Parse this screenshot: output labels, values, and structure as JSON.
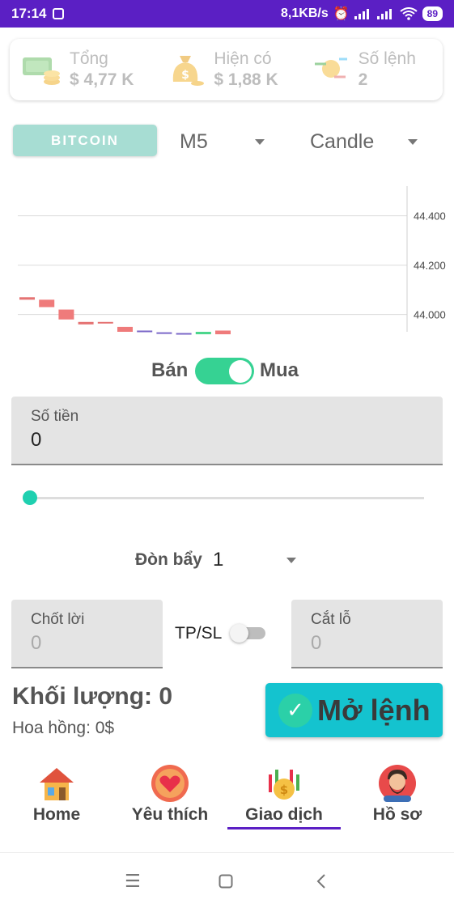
{
  "status_bar": {
    "time": "17:14",
    "net_speed": "8,1KB/s",
    "battery": "89"
  },
  "summary": {
    "total": {
      "label": "Tổng",
      "value": "$ 4,77 K",
      "icon": "money-stack-icon"
    },
    "available": {
      "label": "Hiện có",
      "value": "$ 1,88 K",
      "icon": "money-bag-icon"
    },
    "orders": {
      "label": "Số lệnh",
      "value": "2",
      "icon": "exchange-coins-icon"
    }
  },
  "controls": {
    "asset_button": "BITCOIN",
    "timeframe": "M5",
    "chart_type": "Candle"
  },
  "chart_data": {
    "type": "candlestick",
    "y_tick_labels": [
      "44.400",
      "44.200",
      "44.000"
    ],
    "ylim": [
      43.93,
      44.52
    ],
    "candles": [
      {
        "open": 44.06,
        "close": 44.07,
        "color": "#e57373"
      },
      {
        "open": 44.06,
        "close": 44.03,
        "color": "#ef7b7b"
      },
      {
        "open": 44.02,
        "close": 43.98,
        "color": "#ef7b7b"
      },
      {
        "open": 43.97,
        "close": 43.96,
        "color": "#e57373"
      },
      {
        "open": 43.97,
        "close": 43.965,
        "color": "#e57373"
      },
      {
        "open": 43.95,
        "close": 43.93,
        "color": "#ef7b7b"
      },
      {
        "open": 43.935,
        "close": 43.93,
        "color": "#7b68c8"
      },
      {
        "open": 43.928,
        "close": 43.925,
        "color": "#7b68c8"
      },
      {
        "open": 43.925,
        "close": 43.92,
        "color": "#7b68c8"
      },
      {
        "open": 43.92,
        "close": 43.93,
        "color": "#4cd68c"
      },
      {
        "open": 43.935,
        "close": 43.92,
        "color": "#ef7b7b"
      }
    ],
    "colors": {
      "down": "#ef7b7b",
      "up": "#4cd68c",
      "flat": "#7b68c8"
    }
  },
  "trade": {
    "sell_label": "Bán",
    "buy_label": "Mua",
    "amount_label": "Số tiền",
    "amount_value": "0",
    "slider_value": 0,
    "leverage_label": "Đòn bẩy",
    "leverage_value": "1",
    "take_profit_label": "Chốt lời",
    "take_profit_value": "0",
    "tpsl_label": "TP/SL",
    "stop_loss_label": "Cắt lỗ",
    "stop_loss_value": "0",
    "volume_text": "Khối lượng: 0",
    "commission_text": "Hoa hồng: 0$",
    "open_button": "Mở lệnh"
  },
  "nav": {
    "items": [
      {
        "label": "Home",
        "icon": "house-icon"
      },
      {
        "label": "Yêu thích",
        "icon": "heart-icon"
      },
      {
        "label": "Giao dịch",
        "icon": "trading-coins-icon"
      },
      {
        "label": "Hồ sơ",
        "icon": "profile-avatar-icon"
      }
    ],
    "active": "Giao dịch"
  },
  "colors": {
    "accent": "#5b1fc4",
    "teal": "#14c3cf",
    "toggle_on": "#36d293"
  }
}
